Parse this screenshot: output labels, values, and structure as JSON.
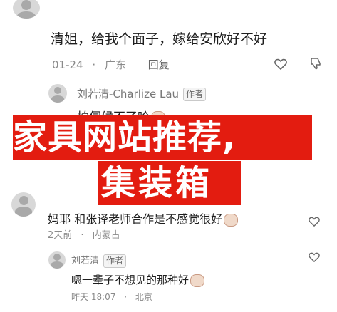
{
  "comment1": {
    "text": "清姐，给我个面子，嫁给安欣好不好",
    "date": "01-24",
    "location": "广东",
    "reply": "回复"
  },
  "reply1": {
    "author": "刘若清-Charlize Lau",
    "badge": "作者",
    "text": "怕伺候不了哈"
  },
  "banner": {
    "line1": "家具网站推荐,",
    "line2": "集装箱",
    "color": "#e31c10"
  },
  "comment2": {
    "text": "妈耶 和张译老师合作是不感觉很好",
    "date": "2天前",
    "location": "内蒙古"
  },
  "reply2": {
    "author": "刘若清",
    "badge": "作者",
    "text": "嗯一辈子不想见的那种好",
    "date": "昨天 18:07",
    "location": "北京"
  },
  "icons": {
    "like": "heart-outline-icon",
    "dislike": "thumbs-down-icon"
  }
}
